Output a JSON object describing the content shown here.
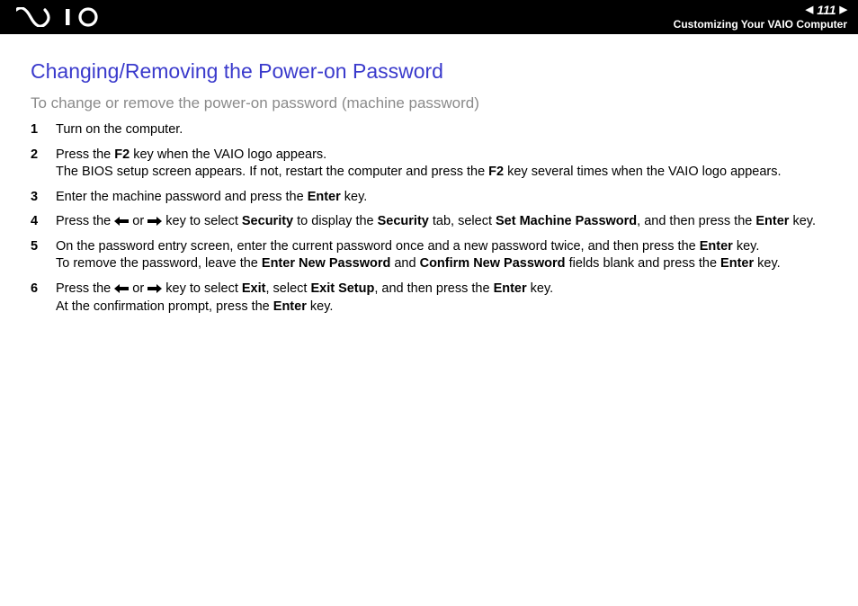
{
  "header": {
    "page_number": "111",
    "breadcrumb": "Customizing Your VAIO Computer"
  },
  "title": "Changing/Removing the Power-on Password",
  "subtitle": "To change or remove the power-on password (machine password)",
  "steps": [
    {
      "num": "1",
      "html": "Turn on the computer."
    },
    {
      "num": "2",
      "html": "Press the <b>F2</b> key when the VAIO logo appears.<br>The BIOS setup screen appears. If not, restart the computer and press the <b>F2</b> key several times when the VAIO logo appears."
    },
    {
      "num": "3",
      "html": "Enter the machine password and press the <b>Enter</b> key."
    },
    {
      "num": "4",
      "html": "Press the {LEFT} or {RIGHT} key to select <b>Security</b> to display the <b>Security</b> tab, select <b>Set Machine Password</b>, and then press the <b>Enter</b> key."
    },
    {
      "num": "5",
      "html": "On the password entry screen, enter the current password once and a new password twice, and then press the <b>Enter</b> key.<br>To remove the password, leave the <b>Enter New Password</b> and <b>Confirm New Password</b> fields blank and press the <b>Enter</b> key."
    },
    {
      "num": "6",
      "html": "Press the {LEFT} or {RIGHT} key to select <b>Exit</b>, select <b>Exit Setup</b>, and then press the <b>Enter</b> key.<br>At the confirmation prompt, press the <b>Enter</b> key."
    }
  ]
}
